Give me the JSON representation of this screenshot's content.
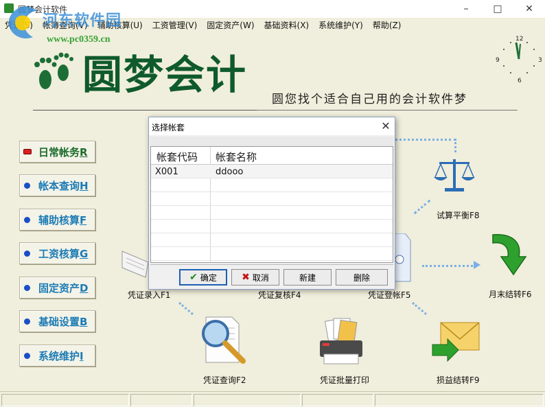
{
  "window": {
    "title": "圆梦会计软件",
    "controls": {
      "minimize": "–",
      "maximize": "□",
      "close": "✕"
    }
  },
  "watermark": {
    "site": "河东软件园",
    "url": "www.pc0359.cn"
  },
  "menu": [
    "凭证(S)",
    "帐簿查询(V)",
    "辅助核算(U)",
    "工资管理(V)",
    "固定资产(W)",
    "基础资料(X)",
    "系统维护(Y)",
    "帮助(Z)"
  ],
  "logo": {
    "text": "圆梦会计",
    "slogan": "圆您找个适合自己用的会计软件梦"
  },
  "clock": {
    "n12": "12",
    "n3": "3",
    "n6": "6",
    "n9": "9"
  },
  "nav": [
    {
      "label": "日常帐务",
      "key": "R"
    },
    {
      "label": "帐本查询",
      "key": "H"
    },
    {
      "label": "辅助核算",
      "key": "F"
    },
    {
      "label": "工资核算",
      "key": "G"
    },
    {
      "label": "固定资产",
      "key": "D"
    },
    {
      "label": "基础设置",
      "key": "B"
    },
    {
      "label": "系统维护",
      "key": "I"
    }
  ],
  "flow": {
    "trial_balance": "试算平衡F8",
    "month_end": "月末结转F6",
    "voucher_entry": "凭证录入F1",
    "voucher_review": "凭证复核F4",
    "voucher_post": "凭证登帐F5",
    "voucher_query": "凭证查询F2",
    "batch_print": "凭证批量打印",
    "profit_loss": "损益结转F9"
  },
  "dialog": {
    "title": "选择帐套",
    "close": "✕",
    "columns": [
      "帐套代码",
      "帐套名称"
    ],
    "rows": [
      {
        "code": "X001",
        "name": "ddooo"
      }
    ],
    "buttons": {
      "ok": "确定",
      "cancel": "取消",
      "new": "新建",
      "delete": "删除"
    }
  },
  "colors": {
    "background": "#f0eedc",
    "nav_text": "#1b7bb5",
    "logo_green": "#0f5a2c",
    "dialog_bg": "#f0f0f0"
  }
}
